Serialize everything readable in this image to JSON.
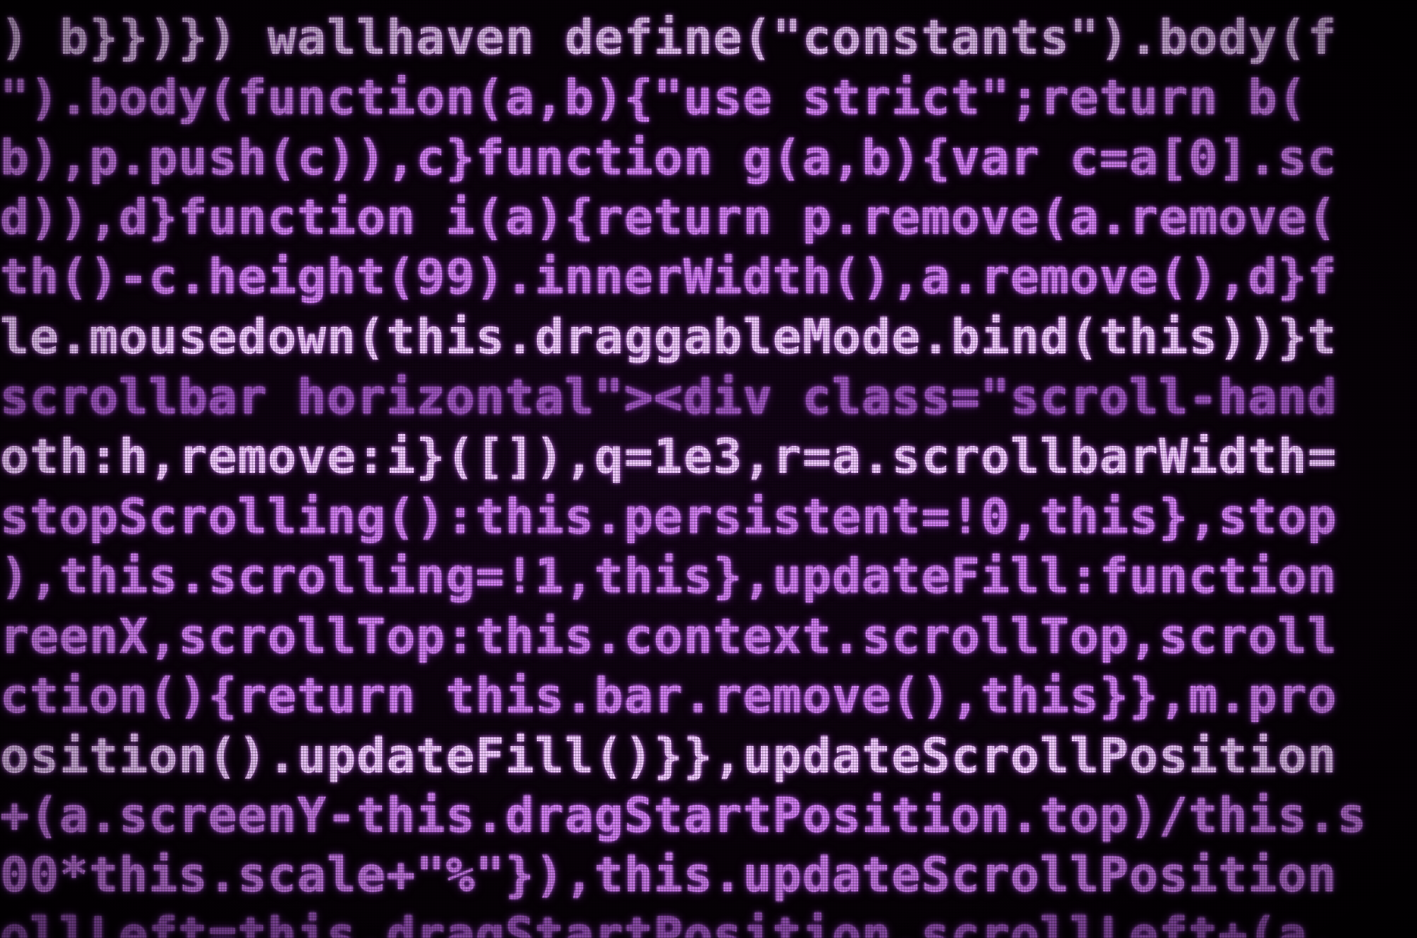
{
  "code_lines": [
    ") b}})}) wallhaven define(\"constants\").body(f",
    "\").body(function(a,b){\"use strict\";return b(",
    "b),p.push(c)),c}function g(a,b){var c=a[0].sc",
    "d)),d}function i(a){return p.remove(a.remove(",
    "th()-c.height(99).innerWidth(),a.remove(),d}f",
    "le.mousedown(this.draggableMode.bind(this))}t",
    "scrollbar horizontal\"><div class=\"scroll-hand",
    "oth:h,remove:i}([]),q=1e3,r=a.scrollbarWidth=",
    "stopScrolling():this.persistent=!0,this},stop",
    "),this.scrolling=!1,this},updateFill:function",
    "reenX,scrollTop:this.context.scrollTop,scroll",
    "ction(){return this.bar.remove(),this}},m.pro",
    "osition().updateFill()}},updateScrollPosition",
    "+(a.screenY-this.dragStartPosition.top)/this.s",
    "00*this.scale+\"%\"}),this.updateScrollPosition",
    "ollLeft=this.dragStartPosition.scrollLeft+(a."
  ],
  "colors": {
    "text": "#d07ef0",
    "background": "#050005",
    "glow": "#b040e6"
  }
}
